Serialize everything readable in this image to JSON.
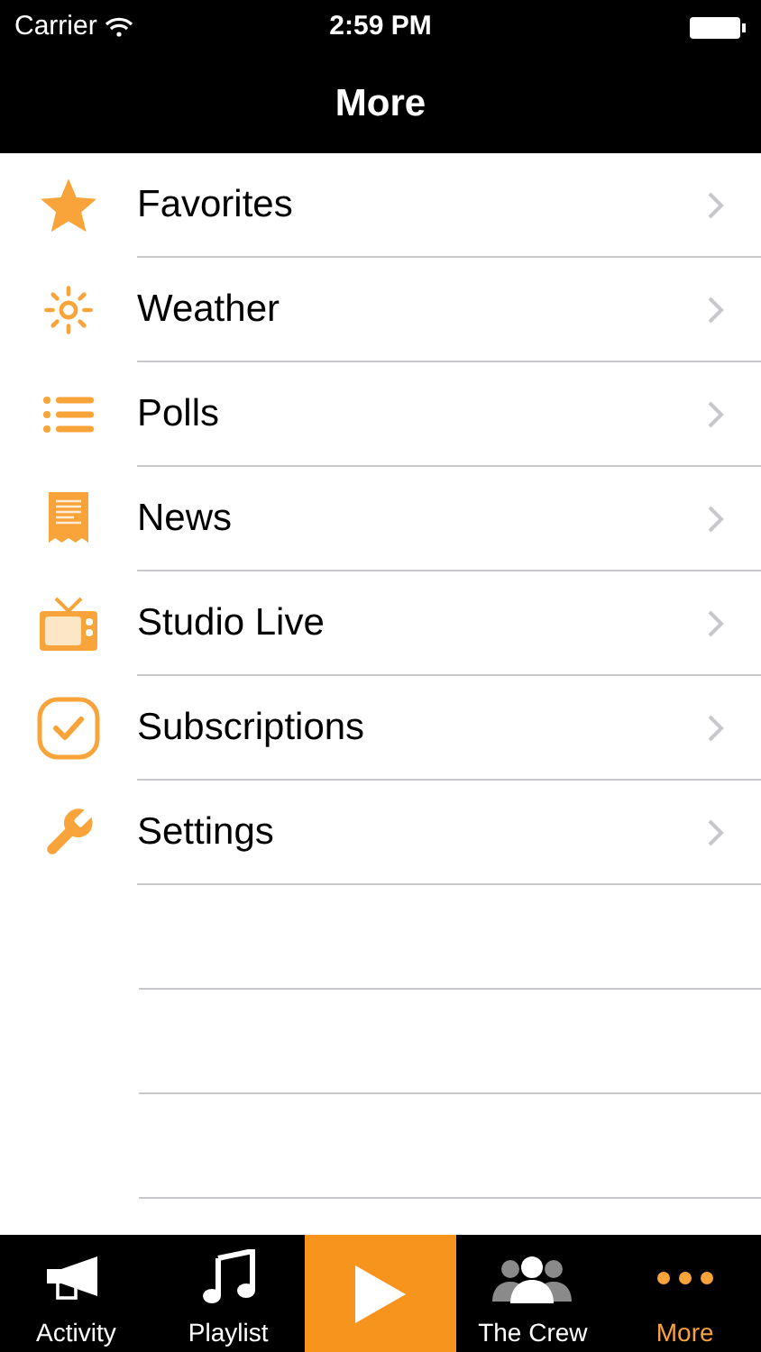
{
  "status_bar": {
    "carrier": "Carrier",
    "time": "2:59 PM"
  },
  "nav_bar": {
    "title": "More"
  },
  "items": [
    {
      "label": "Favorites"
    },
    {
      "label": "Weather"
    },
    {
      "label": "Polls"
    },
    {
      "label": "News"
    },
    {
      "label": "Studio Live"
    },
    {
      "label": "Subscriptions"
    },
    {
      "label": "Settings"
    }
  ],
  "tab_bar": [
    {
      "kind": "tab",
      "label": "Activity",
      "selected": false
    },
    {
      "kind": "tab",
      "label": "Playlist",
      "selected": false
    },
    {
      "kind": "play",
      "selected": false
    },
    {
      "kind": "tab",
      "label": "The Crew",
      "selected": false
    },
    {
      "kind": "tab",
      "label": "More",
      "selected": true
    }
  ]
}
